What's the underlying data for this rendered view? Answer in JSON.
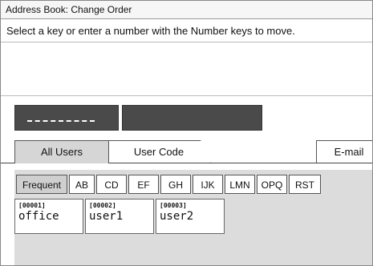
{
  "window": {
    "title": "Address Book: Change Order"
  },
  "instruction": "Select a key or enter a number with the Number keys to move.",
  "tabs": [
    {
      "label": "All Users",
      "active": true
    },
    {
      "label": "User Code",
      "active": false
    },
    {
      "label": "E-mail",
      "active": false
    }
  ],
  "keys": [
    {
      "label": "Frequent",
      "active": true
    },
    {
      "label": "AB",
      "active": false
    },
    {
      "label": "CD",
      "active": false
    },
    {
      "label": "EF",
      "active": false
    },
    {
      "label": "GH",
      "active": false
    },
    {
      "label": "IJK",
      "active": false
    },
    {
      "label": "LMN",
      "active": false
    },
    {
      "label": "OPQ",
      "active": false
    },
    {
      "label": "RST",
      "active": false
    }
  ],
  "entries": [
    {
      "code": "[00001]",
      "name": "office"
    },
    {
      "code": "[00002]",
      "name": "user1"
    },
    {
      "code": "[00003]",
      "name": "user2"
    }
  ]
}
